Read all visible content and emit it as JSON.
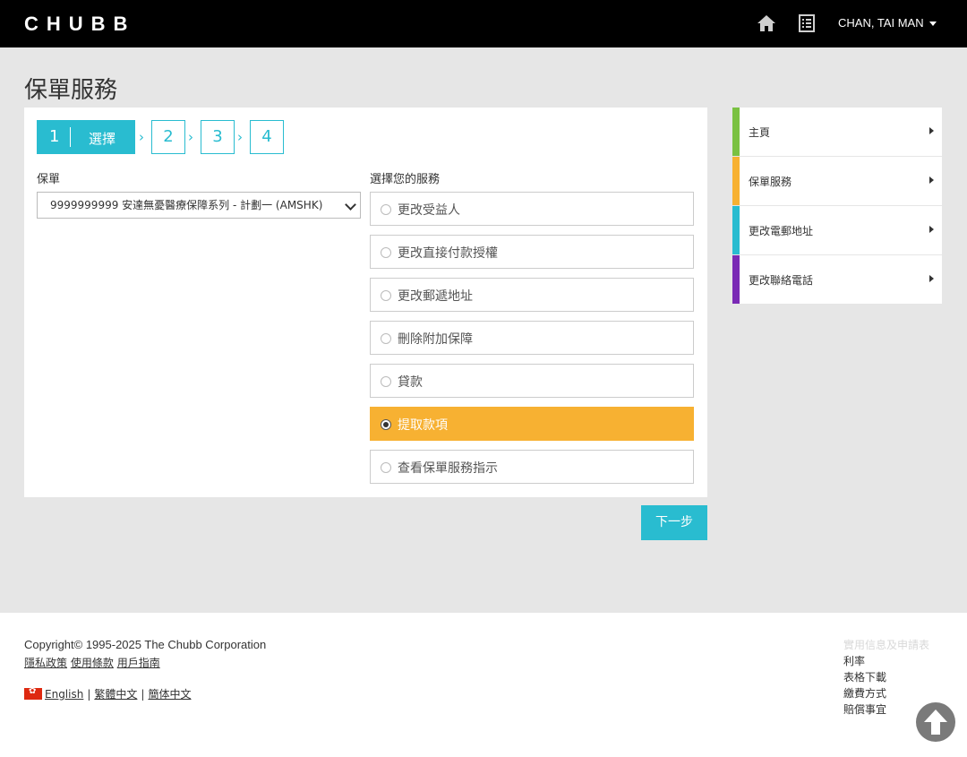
{
  "header": {
    "logo_text": "CHUBB",
    "user_name": "CHAN, TAI MAN"
  },
  "page": {
    "title": "保單服務"
  },
  "stepper": {
    "active_number": "1",
    "active_label": "選擇",
    "steps": [
      "2",
      "3",
      "4"
    ]
  },
  "form": {
    "policy_label": "保單",
    "policy_value": "9999999999 安達無憂醫療保障系列 - 計劃一 (AMSHK)",
    "service_label": "選擇您的服務",
    "options": [
      {
        "label": "更改受益人",
        "selected": false
      },
      {
        "label": "更改直接付款授權",
        "selected": false
      },
      {
        "label": "更改郵遞地址",
        "selected": false
      },
      {
        "label": "刪除附加保障",
        "selected": false
      },
      {
        "label": "貸款",
        "selected": false
      },
      {
        "label": "提取款項",
        "selected": true
      },
      {
        "label": "查看保單服務指示",
        "selected": false
      }
    ],
    "next_label": "下一步"
  },
  "side_nav": {
    "items": [
      {
        "label": "主頁",
        "color": "#7ac142"
      },
      {
        "label": "保單服務",
        "color": "#f7b132"
      },
      {
        "label": "更改電郵地址",
        "color": "#29bcd0"
      },
      {
        "label": "更改聯絡電話",
        "color": "#7a2ab5"
      }
    ]
  },
  "footer": {
    "copyright": "Copyright© 1995-2025 The Chubb Corporation",
    "links": [
      "隱私政策",
      "使用條款",
      "用戶指南"
    ],
    "languages": [
      "English",
      "繁體中文",
      "簡体中文"
    ],
    "right_links_faded": "實用信息及申請表",
    "right_links": [
      "利率",
      "表格下載",
      "繳費方式",
      "賠償事宜"
    ]
  },
  "colors": {
    "accent": "#29bcd0",
    "selected": "#f7b132",
    "header_bg": "#000000",
    "page_bg": "#e6e6e6"
  },
  "icons": [
    "home-icon",
    "document-list-icon",
    "caret-down-icon",
    "chevron-right-icon",
    "arrow-up-icon",
    "hk-flag-icon"
  ]
}
